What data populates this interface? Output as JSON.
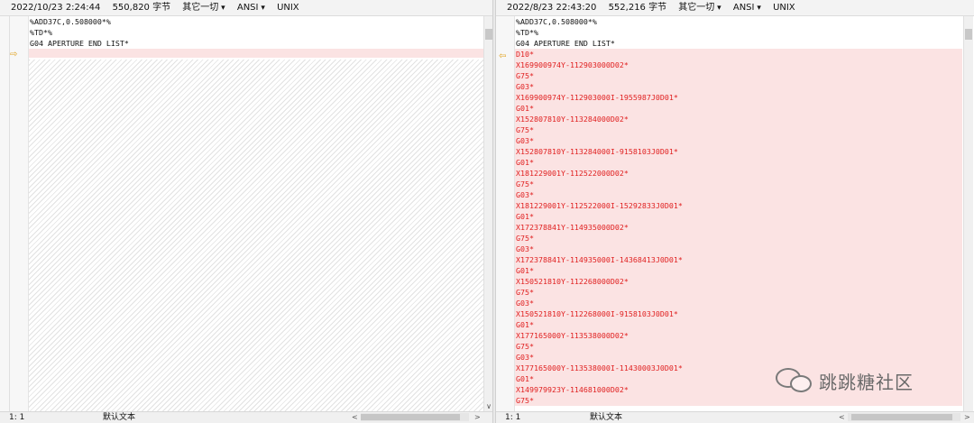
{
  "left": {
    "datetime": "2022/10/23 2:24:44",
    "size": "550,820 字节",
    "menu": "其它一切",
    "encoding": "ANSI",
    "line_ending": "UNIX",
    "lines": [
      "%ADD37C,0.508000*%",
      "%TD*%",
      "G04 APERTURE END LIST*"
    ],
    "status_pos": "1: 1",
    "status_enc": "默认文本"
  },
  "right": {
    "datetime": "2022/8/23 22:43:20",
    "size": "552,216 字节",
    "menu": "其它一切",
    "encoding": "ANSI",
    "line_ending": "UNIX",
    "lines": [
      "%ADD37C,0.508000*%",
      "%TD*%",
      "G04 APERTURE END LIST*"
    ],
    "diff_lines": [
      "D10*",
      "X169900974Y-112903000D02*",
      "G75*",
      "G03*",
      "X169900974Y-112903000I-1955987J0D01*",
      "G01*",
      "X152807810Y-113284000D02*",
      "G75*",
      "G03*",
      "X152807810Y-113284000I-9158103J0D01*",
      "G01*",
      "X181229001Y-112522000D02*",
      "G75*",
      "G03*",
      "X181229001Y-112522000I-15292833J0D01*",
      "G01*",
      "X172378841Y-114935000D02*",
      "G75*",
      "G03*",
      "X172378841Y-114935000I-14368413J0D01*",
      "G01*",
      "X150521810Y-112268000D02*",
      "G75*",
      "G03*",
      "X150521810Y-112268000I-9158103J0D01*",
      "G01*",
      "X177165000Y-113538000D02*",
      "G75*",
      "G03*",
      "X177165000Y-113538000I-11430003J0D01*",
      "G01*",
      "X149979923Y-114681000D02*",
      "G75*"
    ],
    "status_pos": "1: 1",
    "status_enc": "默认文本"
  },
  "watermark": "跳跳糖社区",
  "colors": {
    "diff_text": "#e02020",
    "diff_bg": "#fbe3e3",
    "marker_arrow": "#e0a21f"
  },
  "icons": {
    "left_marker": "arrow-right-icon",
    "right_marker": "arrow-left-icon",
    "watermark_logo": "wechat-icon"
  }
}
